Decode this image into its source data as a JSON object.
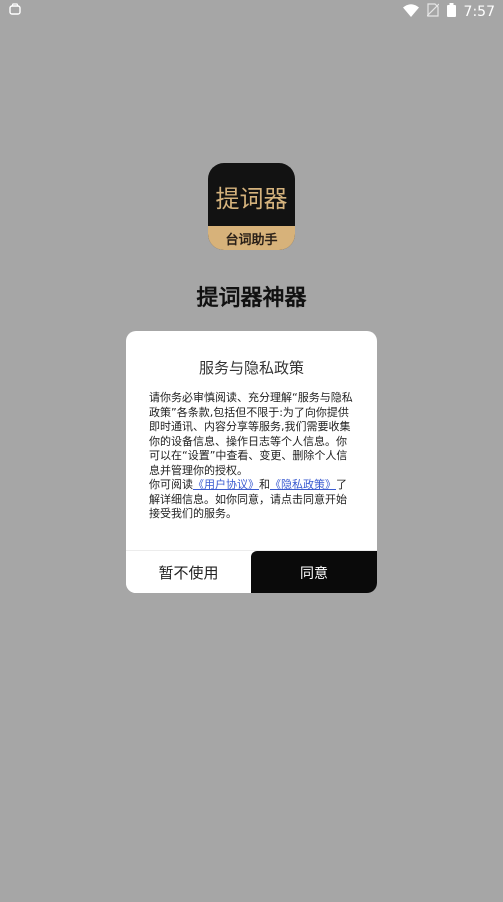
{
  "status_bar": {
    "time": "7:57",
    "icons": [
      "notification-icon",
      "wifi-icon",
      "no-sim-icon",
      "battery-icon"
    ]
  },
  "app": {
    "icon_text": "提词器",
    "icon_banner": "台词助手",
    "name": "提词器神器"
  },
  "dialog": {
    "title": "服务与隐私政策",
    "para1": "请你务必审慎阅读、充分理解“服务与隐私政策”各条款,包括但不限于:为了向你提供即时通讯、内容分享等服务,我们需要收集你的设备信息、操作日志等个人信息。你可以在“设置”中查看、变更、删除个人信息并管理你的授权。",
    "para2_prefix": "你可阅读",
    "link_user": "《用户协议》",
    "para2_and": "和",
    "link_privacy": "《隐私政策》",
    "para2_suffix": "了解详细信息。如你同意，请点击同意开始接受我们的服务。",
    "decline_label": "暂不使用",
    "agree_label": "同意"
  },
  "colors": {
    "backdrop": "#a6a6a6",
    "link": "#3a5bd0",
    "agree_button": "#0a0a0a",
    "icon_gold": "#d7b27a"
  }
}
